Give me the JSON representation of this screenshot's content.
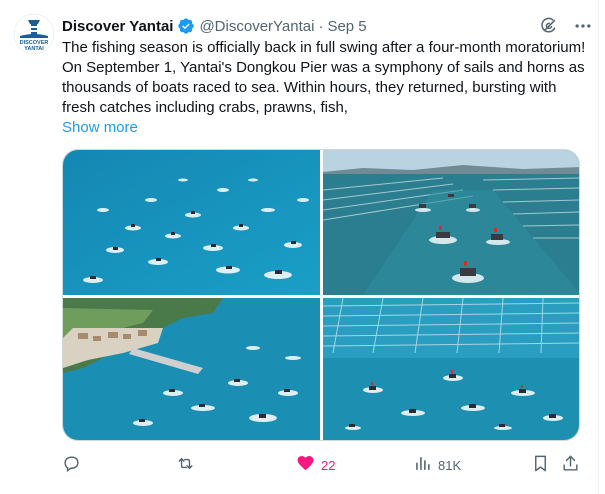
{
  "tweet": {
    "author": {
      "display_name": "Discover Yantai",
      "handle": "@DiscoverYantai",
      "avatar_text_top": "DISCOVER",
      "avatar_text_bottom": "YANTAI",
      "verified": true
    },
    "separator": "·",
    "date": "Sep 5",
    "text": "The fishing season is officially back in full swing after a four-month moratorium! On September 1, Yantai's Dongkou Pier was a symphony of sails and horns as thousands of boats raced to sea. Within hours, they returned, bursting with fresh catches including crabs, prawns, fish,",
    "show_more_label": "Show more",
    "media_count": 4,
    "stats": {
      "replies": "",
      "reposts": "",
      "likes": "22",
      "views": "81K"
    }
  },
  "icons": {
    "grok": "grok-icon",
    "more": "more-horizontal-icon",
    "reply": "reply-icon",
    "repost": "repost-icon",
    "like": "heart-filled-icon",
    "views": "views-chart-icon",
    "bookmark": "bookmark-icon",
    "share": "share-icon",
    "verified": "verified-badge-icon"
  },
  "colors": {
    "text": "#0f1419",
    "secondary": "#536471",
    "link": "#1d9bf0",
    "like": "#f91880",
    "verified": "#1d9bf0",
    "sea": "#1a8fb8"
  }
}
